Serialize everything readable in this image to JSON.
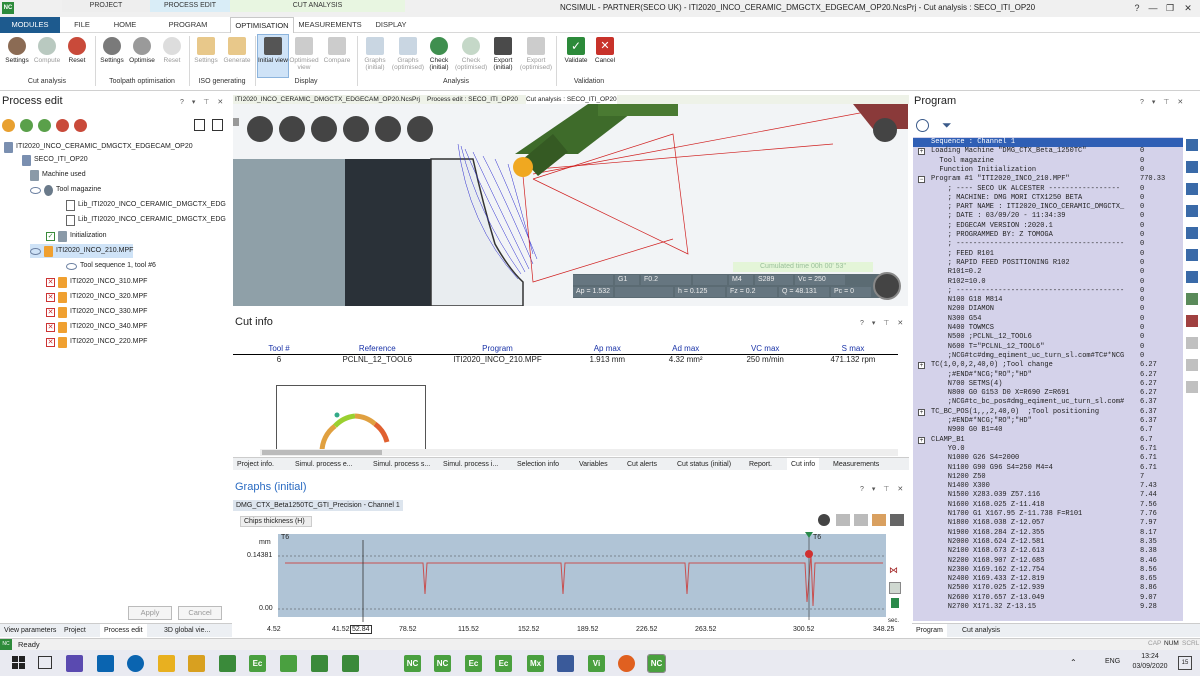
{
  "titlebar": {
    "logo": "NC",
    "groups": [
      "PROJECT",
      "PROCESS EDIT",
      "CUT ANALYSIS"
    ],
    "title": "NCSIMUL - PARTNER(SECO UK) - ITI2020_INCO_CERAMIC_DMGCTX_EDGECAM_OP20.NcsPrj - Cut analysis : SECO_ITI_OP20",
    "controls": [
      "?",
      "—",
      "❐",
      "✕"
    ]
  },
  "tabs": [
    "MODULES",
    "FILE",
    "HOME",
    "PROGRAM",
    "OPTIMISATION",
    "MEASUREMENTS",
    "DISPLAY"
  ],
  "ribbon": {
    "cut_analysis": {
      "label": "Cut analysis",
      "buttons": [
        "Settings",
        "Compute",
        "Reset"
      ]
    },
    "toolpath": {
      "label": "Toolpath optimisation",
      "buttons": [
        "Settings",
        "Optimise",
        "Reset"
      ]
    },
    "iso": {
      "label": "ISO generating",
      "buttons": [
        "Settings",
        "Generate"
      ]
    },
    "display": {
      "label": "Display",
      "buttons": [
        "Initial view",
        "Optimised view",
        "Compare"
      ]
    },
    "analysis": {
      "label": "Analysis",
      "buttons": [
        "Graphs (initial)",
        "Graphs (optimised)",
        "Check (initial)",
        "Check (optimised)",
        "Export (initial)",
        "Export (optimised)"
      ]
    },
    "validation": {
      "label": "Validation",
      "buttons": [
        "Validate",
        "Cancel"
      ]
    }
  },
  "process_edit": {
    "title": "Process edit",
    "controls": "? ▾ ⊤ ✕",
    "tree": [
      "ITI2020_INCO_CERAMIC_DMGCTX_EDGECAM_OP20",
      "SECO_ITI_OP20",
      "Machine used",
      "Tool magazine",
      "Lib_ITI2020_INCO_CERAMIC_DMGCTX_EDG",
      "Lib_ITI2020_INCO_CERAMIC_DMGCTX_EDG",
      "Initialization",
      "ITI2020_INCO_210.MPF",
      "Tool sequence 1,  tool #6",
      "ITI2020_INCO_310.MPF",
      "ITI2020_INCO_320.MPF",
      "ITI2020_INCO_330.MPF",
      "ITI2020_INCO_340.MPF",
      "ITI2020_INCO_220.MPF"
    ],
    "apply": "Apply",
    "cancel": "Cancel",
    "bottom_tabs": [
      "View parameters",
      "Project",
      "Process edit",
      "3D global vie..."
    ]
  },
  "doc_tabs": [
    "ITI2020_INCO_CERAMIC_DMGCTX_EDGECAM_OP20.NcsPrj",
    "Process edit : SECO_ITI_OP20",
    "Cut analysis : SECO_ITI_OP20"
  ],
  "viewport": {
    "cumulated": "Cumulated time      00h 00' 53\"",
    "r1": [
      "",
      "G1",
      "F0.2",
      "",
      "M4",
      "S289",
      "Vc = 250"
    ],
    "r2": [
      "Ap = 1.532",
      "",
      "h = 0.125",
      "Fz = 0.2",
      "Q = 48.131",
      "Pc = 0"
    ]
  },
  "cut_info": {
    "title": "Cut info",
    "headers": [
      "Tool #",
      "Reference",
      "Program",
      "Ap max",
      "Ad max",
      "VC max",
      "S max"
    ],
    "row": [
      "6",
      "PCLNL_12_TOOL6",
      "ITI2020_INCO_210.MPF",
      "1.913 mm",
      "4.32 mm²",
      "250 m/min",
      "471.132 rpm"
    ],
    "tabs": [
      "Project info.",
      "Simul. process e...",
      "Simul. process s...",
      "Simul. process i...",
      "Selection info",
      "Variables",
      "Cut alerts",
      "Cut status (initial)",
      "Report.",
      "Cut info",
      "Measurements"
    ]
  },
  "graphs": {
    "title": "Graphs (initial)",
    "tab": "DMG_CTX_Beta1250TC_GTI_Precision - Channel 1",
    "subtab": "Chips thickness (H)",
    "y_unit": "mm",
    "y_top": "0.14381",
    "y_zero": "0.00",
    "marker_left": "T6",
    "marker_right": "T6",
    "x_ticks": [
      "4.52",
      "41.52",
      "52.84",
      "78.52",
      "115.52",
      "152.52",
      "189.52",
      "226.52",
      "263.52",
      "300.52",
      "348.25"
    ],
    "x_unit": "sec."
  },
  "program": {
    "title": "Program",
    "controls": "? ▾ ⊤ ✕",
    "lines": [
      {
        "mk": "",
        "t": "Sequence : Channel 1",
        "n": ""
      },
      {
        "mk": "+",
        "t": "Loading Machine \"DMG_CTX_Beta_1250TC\"",
        "n": "0"
      },
      {
        "mk": "",
        "t": "  Tool magazine",
        "n": "0"
      },
      {
        "mk": "",
        "t": "  Function Initialization",
        "n": "0"
      },
      {
        "mk": "−",
        "t": "Program #1 \"ITI2020_INCO_210.MPF\"",
        "n": "770.33"
      },
      {
        "mk": "",
        "t": "    ; ---- SECO UK ALCESTER -----------------",
        "n": "0"
      },
      {
        "mk": "",
        "t": "    ; MACHINE: DMG MORI CTX1250 BETA",
        "n": "0"
      },
      {
        "mk": "",
        "t": "    ; PART NAME : ITI2020_INCO_CERAMIC_DMGCTX_",
        "n": "0"
      },
      {
        "mk": "",
        "t": "    ; DATE : 03/09/20 - 11:34:39",
        "n": "0"
      },
      {
        "mk": "",
        "t": "    ; EDGECAM VERSION :2020.1",
        "n": "0"
      },
      {
        "mk": "",
        "t": "    ; PROGRAMMED BY: Z TOMOGA",
        "n": "0"
      },
      {
        "mk": "",
        "t": "    ; ----------------------------------------",
        "n": "0"
      },
      {
        "mk": "",
        "t": "    ; FEED R101",
        "n": "0"
      },
      {
        "mk": "",
        "t": "    ; RAPID FEED POSITIONING R102",
        "n": "0"
      },
      {
        "mk": "",
        "t": "    R101=0.2",
        "n": "0"
      },
      {
        "mk": "",
        "t": "    R102=10.0",
        "n": "0"
      },
      {
        "mk": "",
        "t": "    ; ----------------------------------------",
        "n": "0"
      },
      {
        "mk": "",
        "t": "    N100 G18 M814",
        "n": "0"
      },
      {
        "mk": "",
        "t": "    N200 DIAMON",
        "n": "0"
      },
      {
        "mk": "",
        "t": "    N300 G54",
        "n": "0"
      },
      {
        "mk": "",
        "t": "    N400 TOWMCS",
        "n": "0"
      },
      {
        "mk": "",
        "t": "    N500 ;PCLNL_12_TOOL6",
        "n": "0"
      },
      {
        "mk": "",
        "t": "    N600 T=\"PCLNL_12_TOOL6\"",
        "n": "0"
      },
      {
        "mk": "",
        "t": "    ;NCG#tc#dmg_eqiment_uc_turn_sl.com#TC#*NCG",
        "n": "0"
      },
      {
        "mk": "+",
        "t": "TC(1,0,0,2,40,0) ;Tool change",
        "n": "6.27"
      },
      {
        "mk": "",
        "t": "    ;#END#*NCG;\"RO\";\"HD\"",
        "n": "6.27"
      },
      {
        "mk": "",
        "t": "    N700 SETMS(4)",
        "n": "6.27"
      },
      {
        "mk": "",
        "t": "    N800 G0 G153 D0 X=R690 Z=R691",
        "n": "6.27"
      },
      {
        "mk": "",
        "t": "    ;NCG#tc_bc_pos#dmg_eqiment_uc_turn_sl.com#",
        "n": "6.37"
      },
      {
        "mk": "+",
        "t": "TC_BC_POS(1,,,2,40,0)  ;Tool positioning",
        "n": "6.37"
      },
      {
        "mk": "",
        "t": "    ;#END#*NCG;\"RO\";\"HD\"",
        "n": "6.37"
      },
      {
        "mk": "",
        "t": "    N900 G0 B1=40",
        "n": "6.7"
      },
      {
        "mk": "+",
        "t": "CLAMP_B1",
        "n": "6.7"
      },
      {
        "mk": "",
        "t": "    Y0.0",
        "n": "6.71"
      },
      {
        "mk": "",
        "t": "    N1000 G26 S4=2000",
        "n": "6.71"
      },
      {
        "mk": "",
        "t": "    N1100 G90 G96 S4=250 M4=4",
        "n": "6.71"
      },
      {
        "mk": "",
        "t": "    N1200 Z50",
        "n": "7"
      },
      {
        "mk": "",
        "t": "    N1400 X300",
        "n": "7.43"
      },
      {
        "mk": "",
        "t": "    N1500 X283.039 Z57.116",
        "n": "7.44"
      },
      {
        "mk": "",
        "t": "    N1600 X168.025 Z-11.418",
        "n": "7.56"
      },
      {
        "mk": "",
        "t": "    N1700 G1 X167.95 Z-11.738 F=R101",
        "n": "7.76"
      },
      {
        "mk": "",
        "t": "    N1800 X168.038 Z-12.057",
        "n": "7.97"
      },
      {
        "mk": "",
        "t": "    N1900 X168.284 Z-12.355",
        "n": "8.17"
      },
      {
        "mk": "",
        "t": "    N2000 X168.624 Z-12.581",
        "n": "8.35"
      },
      {
        "mk": "",
        "t": "    N2100 X168.673 Z-12.613",
        "n": "8.38"
      },
      {
        "mk": "",
        "t": "    N2200 X168.907 Z-12.685",
        "n": "8.46"
      },
      {
        "mk": "",
        "t": "    N2300 X169.162 Z-12.754",
        "n": "8.56"
      },
      {
        "mk": "",
        "t": "    N2400 X169.433 Z-12.819",
        "n": "8.65"
      },
      {
        "mk": "",
        "t": "    N2500 X170.025 Z-12.939",
        "n": "8.86"
      },
      {
        "mk": "",
        "t": "    N2600 X170.657 Z-13.049",
        "n": "9.07"
      },
      {
        "mk": "",
        "t": "    N2700 X171.32 Z-13.15",
        "n": "9.28"
      }
    ],
    "bottom_tabs": [
      "Program",
      "Cut analysis"
    ]
  },
  "status": {
    "ready": "Ready",
    "indicators": [
      "CAP",
      "NUM",
      "SCRL"
    ]
  },
  "taskbar": {
    "apps": [
      "",
      "",
      "",
      "",
      "",
      "",
      "Ec",
      "",
      "",
      "",
      "NC",
      "NC",
      "Ec",
      "Ec",
      "Mx",
      "",
      "Vi",
      "",
      "NC"
    ],
    "lang": "ENG",
    "time": "13:24",
    "date": "03/09/2020",
    "notif": "15"
  }
}
